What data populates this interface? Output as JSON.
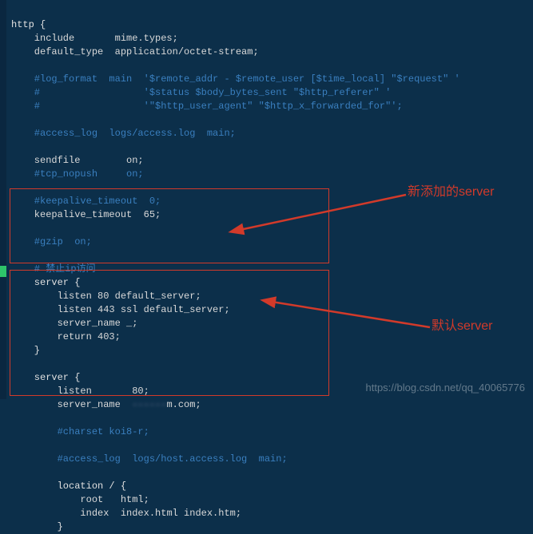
{
  "code": {
    "l1_a": "http {",
    "l2_a": "    include       ",
    "l2_b": "mime.types;",
    "l3_a": "    default_type  ",
    "l3_b": "application/octet-stream;",
    "l4": "",
    "l5": "    #log_format  main  '$remote_addr - $remote_user [$time_local] \"$request\" '",
    "l6": "    #                  '$status $body_bytes_sent \"$http_referer\" '",
    "l7": "    #                  '\"$http_user_agent\" \"$http_x_forwarded_for\"';",
    "l8": "",
    "l9": "    #access_log  logs/access.log  main;",
    "l10": "",
    "l11_a": "    sendfile        ",
    "l11_b": "on;",
    "l12": "    #tcp_nopush     on;",
    "l13": "",
    "l14": "    #keepalive_timeout  0;",
    "l15_a": "    keepalive_timeout  ",
    "l15_b": "65;",
    "l16": "",
    "l17": "    #gzip  on;",
    "l18": "",
    "l19": "    # 禁止ip访问",
    "l20": "    server {",
    "l21_a": "        listen ",
    "l21_b": "80 default_server;",
    "l22_a": "        listen ",
    "l22_b": "443 ssl default_server;",
    "l23_a": "        server_name ",
    "l23_b": "_;",
    "l24_a": "        return ",
    "l24_b": "403;",
    "l25": "    }",
    "l26": "",
    "l27": "    server {",
    "l28_a": "        listen       ",
    "l28_b": "80;",
    "l29_a": "        server_name  ",
    "l29_blur": "------",
    "l29_c": "m.com;",
    "l30": "",
    "l31": "        #charset koi8-r;",
    "l32": "",
    "l33": "        #access_log  logs/host.access.log  main;",
    "l34": "",
    "l35": "        location / {",
    "l36_a": "            root   ",
    "l36_b": "html;",
    "l37_a": "            index  ",
    "l37_b": "index.html index.htm;",
    "l38": "        }"
  },
  "labels": {
    "newServer": "新添加的server",
    "defaultServer": "默认server"
  },
  "watermark": "https://blog.csdn.net/qq_40065776"
}
